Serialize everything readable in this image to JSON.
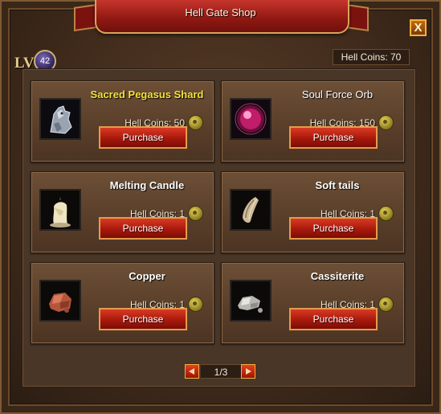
{
  "window": {
    "title": "Hell Gate Shop",
    "close_label": "X"
  },
  "player": {
    "lv_label": "LV",
    "level": "42",
    "coins_text": "Hell Coins: 70"
  },
  "items": [
    {
      "name": "Sacred Pegasus Shard",
      "price": "Hell Coins: 50",
      "button": "Purchase",
      "icon": "pegasus-shard-icon"
    },
    {
      "name": "Soul Force Orb",
      "price": "Hell Coins: 150",
      "button": "Purchase",
      "icon": "soul-orb-icon"
    },
    {
      "name": "Melting Candle",
      "price": "Hell Coins: 1",
      "button": "Purchase",
      "icon": "candle-icon"
    },
    {
      "name": "Soft tails",
      "price": "Hell Coins: 1",
      "button": "Purchase",
      "icon": "tail-icon"
    },
    {
      "name": "Copper",
      "price": "Hell Coins: 1",
      "button": "Purchase",
      "icon": "copper-ore-icon"
    },
    {
      "name": "Cassiterite",
      "price": "Hell Coins: 1",
      "button": "Purchase",
      "icon": "cassiterite-ore-icon"
    }
  ],
  "pagination": {
    "label": "1/3"
  },
  "colors": {
    "highlight_name": "#f3e23a",
    "button_red": "#a8180c",
    "ribbon_red": "#8f1812"
  }
}
